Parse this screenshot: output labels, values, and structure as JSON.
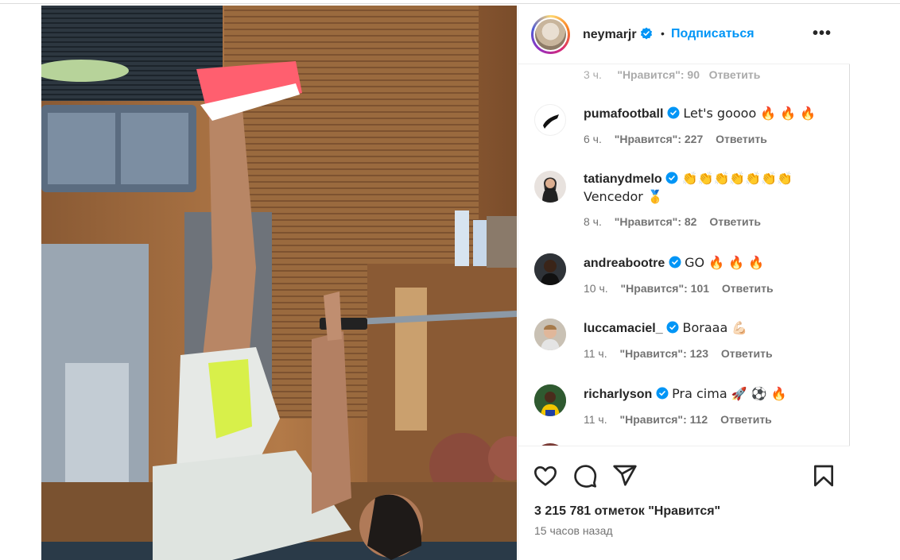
{
  "post": {
    "author": "neymarjr",
    "follow_label": "Подписаться",
    "separator": "•",
    "more_label": "•••",
    "likes_text": "3 215 781 отметок \"Нравится\"",
    "time_ago": "15 часов назад"
  },
  "partial_comment": {
    "time": "3 ч.",
    "likes": "\"Нравится\": 90",
    "reply": "Ответить"
  },
  "comments": [
    {
      "user": "pumafootball",
      "text": "Let's goooo 🔥 🔥 🔥",
      "time": "6 ч.",
      "likes": "\"Нравится\": 227",
      "reply": "Ответить"
    },
    {
      "user": "tatianydmelo",
      "text": "👏👏👏👏👏👏👏 Vencedor 🥇",
      "time": "8 ч.",
      "likes": "\"Нравится\": 82",
      "reply": "Ответить"
    },
    {
      "user": "andreabootre",
      "text": "GO 🔥 🔥 🔥",
      "time": "10 ч.",
      "likes": "\"Нравится\": 101",
      "reply": "Ответить"
    },
    {
      "user": "luccamaciel_",
      "text": "Boraaa 💪🏻",
      "time": "11 ч.",
      "likes": "\"Нравится\": 123",
      "reply": "Ответить"
    },
    {
      "user": "richarlyson",
      "text": "Pra cima 🚀 ⚽ 🔥",
      "time": "11 ч.",
      "likes": "\"Нравится\": 112",
      "reply": "Ответить"
    }
  ],
  "icons": {
    "verified": "verified-badge-icon",
    "like": "heart-icon",
    "comment": "comment-bubble-icon",
    "share": "paper-plane-icon",
    "save": "bookmark-icon",
    "next": "chevron-right-icon"
  },
  "colors": {
    "accent": "#0095f6",
    "text": "#262626",
    "muted": "#737373"
  }
}
